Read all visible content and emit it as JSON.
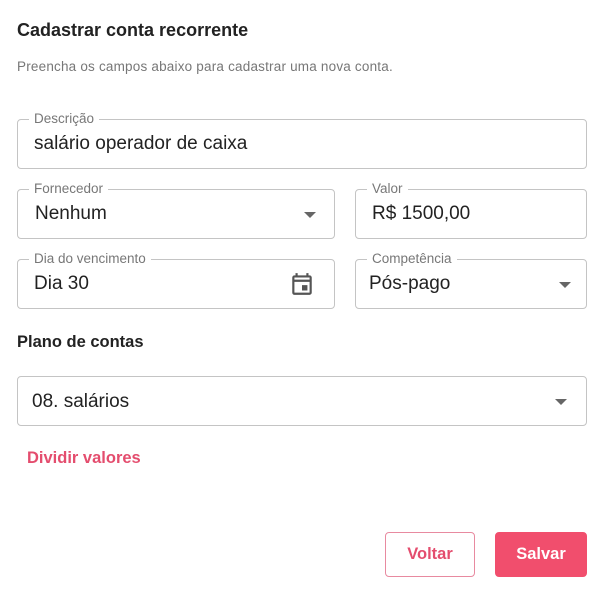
{
  "dialog": {
    "title": "Cadastrar conta recorrente",
    "subtitle": "Preencha os campos abaixo para cadastrar uma nova conta."
  },
  "fields": {
    "descricao": {
      "label": "Descrição",
      "value": "salário operador de caixa"
    },
    "fornecedor": {
      "label": "Fornecedor",
      "value": "Nenhum",
      "icon": "chevron-down-icon"
    },
    "valor": {
      "label": "Valor",
      "value": "R$ 1500,00"
    },
    "vencimento": {
      "label": "Dia do vencimento",
      "value": "Dia 30",
      "icon": "calendar-icon"
    },
    "competencia": {
      "label": "Competência",
      "value": "Pós-pago",
      "icon": "chevron-down-icon"
    }
  },
  "plano": {
    "title": "Plano de contas",
    "value": "08. salários",
    "icon": "chevron-down-icon"
  },
  "actions": {
    "split_label": "Dividir valores",
    "back_label": "Voltar",
    "save_label": "Salvar"
  },
  "colors": {
    "accent": "#f14e6d",
    "accent_text": "#e44d6e",
    "border": "#c4c4c4",
    "muted_text": "#777777"
  }
}
